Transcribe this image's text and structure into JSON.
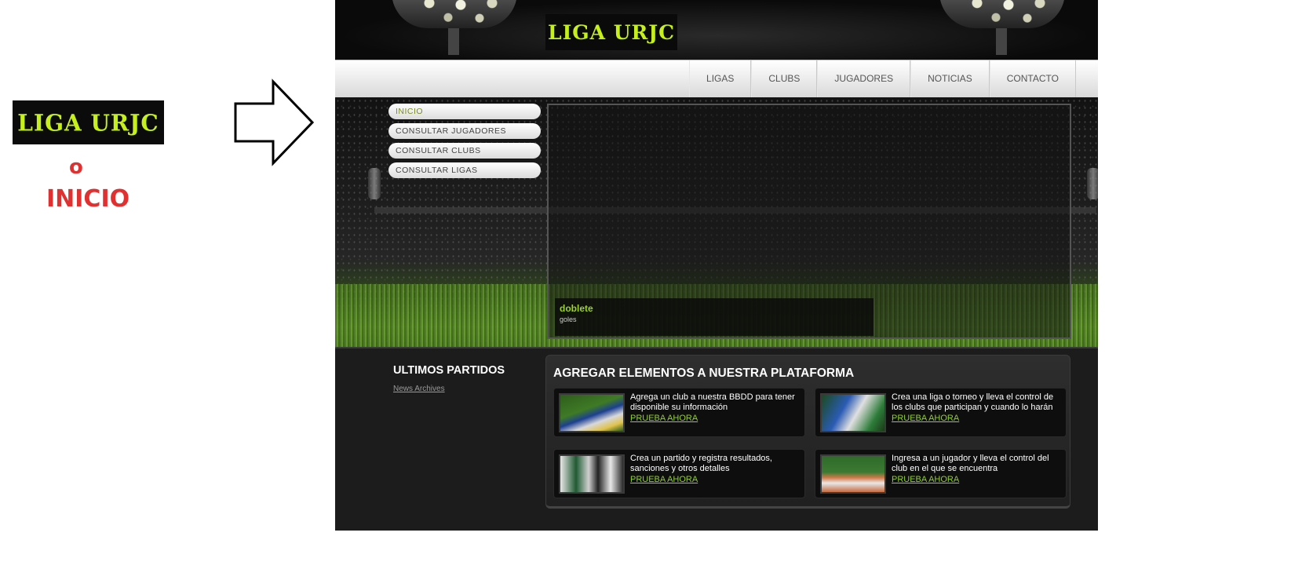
{
  "annotation": {
    "logo_text": "LIGA URJC",
    "or_text": "o",
    "inicio_text": "INICIO"
  },
  "header": {
    "logo_text": "LIGA URJC"
  },
  "nav": {
    "items": [
      "LIGAS",
      "CLUBS",
      "JUGADORES",
      "NOTICIAS",
      "CONTACTO"
    ]
  },
  "sidebar": {
    "items": [
      {
        "label": "INICIO"
      },
      {
        "label": "CONSULTAR JUGADORES"
      },
      {
        "label": "CONSULTAR CLUBS"
      },
      {
        "label": "CONSULTAR LIGAS"
      }
    ]
  },
  "slider": {
    "caption_title": "doblete",
    "caption_subtitle": "goles"
  },
  "ultimos": {
    "title": "ULTIMOS PARTIDOS",
    "link": "News Archives"
  },
  "panel": {
    "title": "AGREGAR ELEMENTOS A NUESTRA PLATAFORMA",
    "cards": [
      {
        "text": "Agrega un club a nuestra BBDD para tener disponible su información",
        "cta": "PRUEBA AHORA"
      },
      {
        "text": "Crea una liga o torneo y lleva el control de los clubs que participan y cuando lo harán",
        "cta": "PRUEBA AHORA"
      },
      {
        "text": "Crea un partido y registra resultados, sanciones y otros detalles",
        "cta": "PRUEBA AHORA"
      },
      {
        "text": "Ingresa a un jugador y lleva el control del club en el que se encuentra",
        "cta": "PRUEBA AHORA"
      }
    ]
  },
  "colors": {
    "logo_green": "#c6f01c",
    "accent_green": "#8fd12a",
    "annotation_red": "#e03030"
  }
}
